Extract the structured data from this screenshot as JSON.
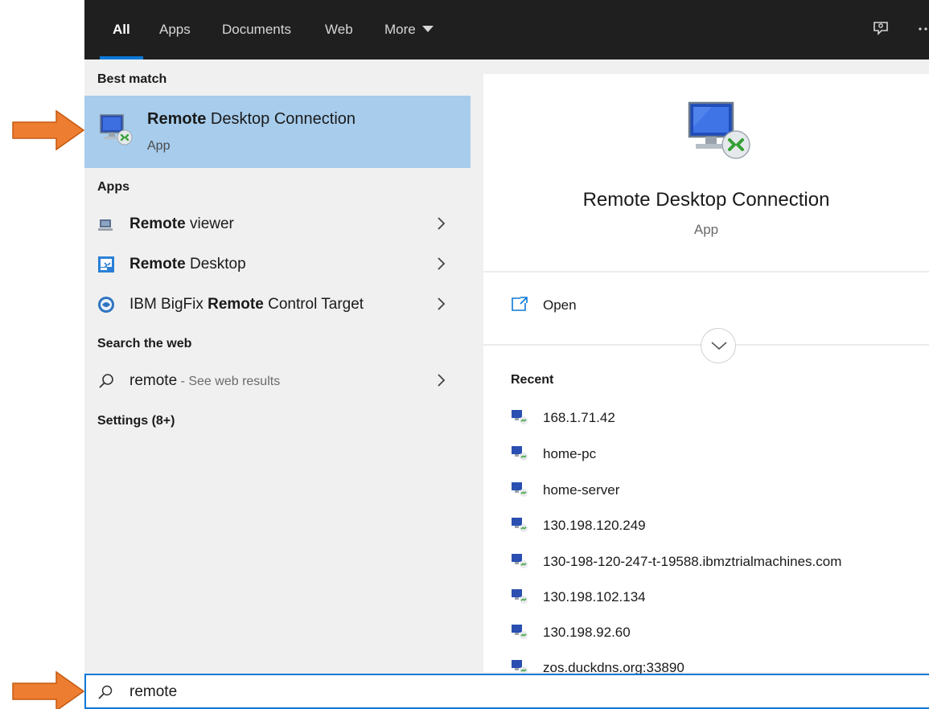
{
  "nav": {
    "tabs": [
      {
        "label": "All",
        "active": true
      },
      {
        "label": "Apps"
      },
      {
        "label": "Documents"
      },
      {
        "label": "Web"
      },
      {
        "label": "More"
      }
    ],
    "icons": [
      "feedback-icon",
      "more-options-icon"
    ]
  },
  "best_match": {
    "header": "Best match",
    "title_bold": "Remote",
    "title_rest": " Desktop Connection",
    "subtitle": "App"
  },
  "apps": {
    "header": "Apps",
    "items": [
      {
        "bold": "Remote",
        "rest": " viewer",
        "icon": "remote-viewer-icon"
      },
      {
        "bold": "Remote",
        "rest": " Desktop",
        "icon": "remote-desktop-icon"
      },
      {
        "prefix": "IBM BigFix ",
        "bold": "Remote",
        "rest": " Control Target",
        "icon": "bigfix-icon"
      }
    ]
  },
  "web": {
    "header": "Search the web",
    "query": "remote",
    "hint": " - See web results"
  },
  "settings": {
    "header": "Settings (8+)"
  },
  "preview": {
    "title": "Remote Desktop Connection",
    "subtitle": "App",
    "open_label": "Open",
    "recent_header": "Recent",
    "recent": [
      "168.1.71.42",
      "home-pc",
      "home-server",
      "130.198.120.249",
      "130-198-120-247-t-19588.ibmztrialmachines.com",
      "130.198.102.134",
      "130.198.92.60",
      "zos.duckdns.org:33890"
    ]
  },
  "search": {
    "value": "remote"
  },
  "colors": {
    "accent": "#0a78d7",
    "selected": "#a7ccec",
    "topbar": "#1f1f1f",
    "arrow": "#ed7d31"
  }
}
